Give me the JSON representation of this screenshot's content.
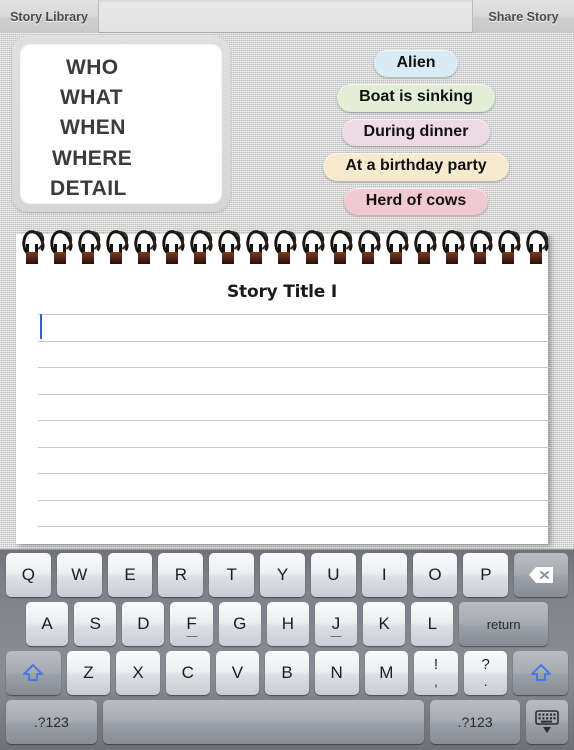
{
  "toolbar": {
    "left_button": "Story Library",
    "right_button": "Share Story"
  },
  "prompt_panel": {
    "words": [
      "WHO",
      "WHAT",
      "WHEN",
      "WHERE",
      "DETAIL"
    ]
  },
  "pills": [
    {
      "label": "Alien",
      "color": "#d9ecf6"
    },
    {
      "label": "Boat is sinking",
      "color": "#e3eed6"
    },
    {
      "label": "During dinner",
      "color": "#eedbe6"
    },
    {
      "label": "At a birthday party",
      "color": "#f7ebcf"
    },
    {
      "label": "Herd of cows",
      "color": "#f0c9d2"
    }
  ],
  "notepad": {
    "title": "Story Title I",
    "line_count": 9,
    "caret_visible": true,
    "body_text": ""
  },
  "keyboard": {
    "row1": [
      "Q",
      "W",
      "E",
      "R",
      "T",
      "Y",
      "U",
      "I",
      "O",
      "P"
    ],
    "row1_extra": "backspace-icon",
    "row2": [
      "A",
      "S",
      "D",
      "F",
      "G",
      "H",
      "J",
      "K",
      "L"
    ],
    "row2_extra": "return",
    "row3_shift": "shift-icon",
    "row3": [
      "Z",
      "X",
      "C",
      "V",
      "B",
      "N",
      "M"
    ],
    "row3_dual": [
      {
        "up": "!",
        "lo": ","
      },
      {
        "up": "?",
        "lo": "."
      }
    ],
    "row4": {
      "num_left": ".?123",
      "space": "",
      "num_right": ".?123",
      "dismiss": "hide-keyboard-icon"
    }
  },
  "colors": {
    "background": "#cfd0cf",
    "caret": "#3a5bd9",
    "keyboard_bg": "#7c8086",
    "key_face": "#eceef0"
  }
}
